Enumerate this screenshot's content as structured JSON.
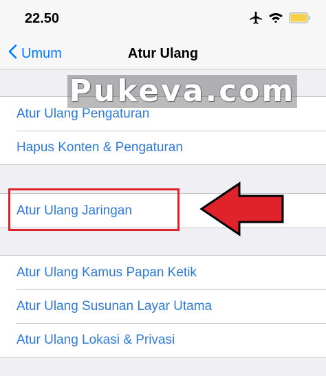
{
  "status_bar": {
    "time": "22.50",
    "icons": [
      "airplane-icon",
      "wifi-icon",
      "battery-icon"
    ],
    "battery_color": "#f7d046"
  },
  "nav": {
    "back_label": "Umum",
    "title": "Atur Ulang"
  },
  "watermark": "Pukeva.com",
  "groups": [
    {
      "items": [
        "Atur Ulang Pengaturan",
        "Hapus Konten & Pengaturan"
      ]
    },
    {
      "items": [
        "Atur Ulang Jaringan"
      ]
    },
    {
      "items": [
        "Atur Ulang Kamus Papan Ketik",
        "Atur Ulang Susunan Layar Utama",
        "Atur Ulang Lokasi & Privasi"
      ]
    }
  ],
  "annotation": {
    "highlight_color": "#e0232b",
    "arrow_color": "#e0232b",
    "target": "Atur Ulang Jaringan"
  },
  "colors": {
    "accent": "#007aff",
    "row_text": "#2f7ad6",
    "background": "#efeff4"
  }
}
